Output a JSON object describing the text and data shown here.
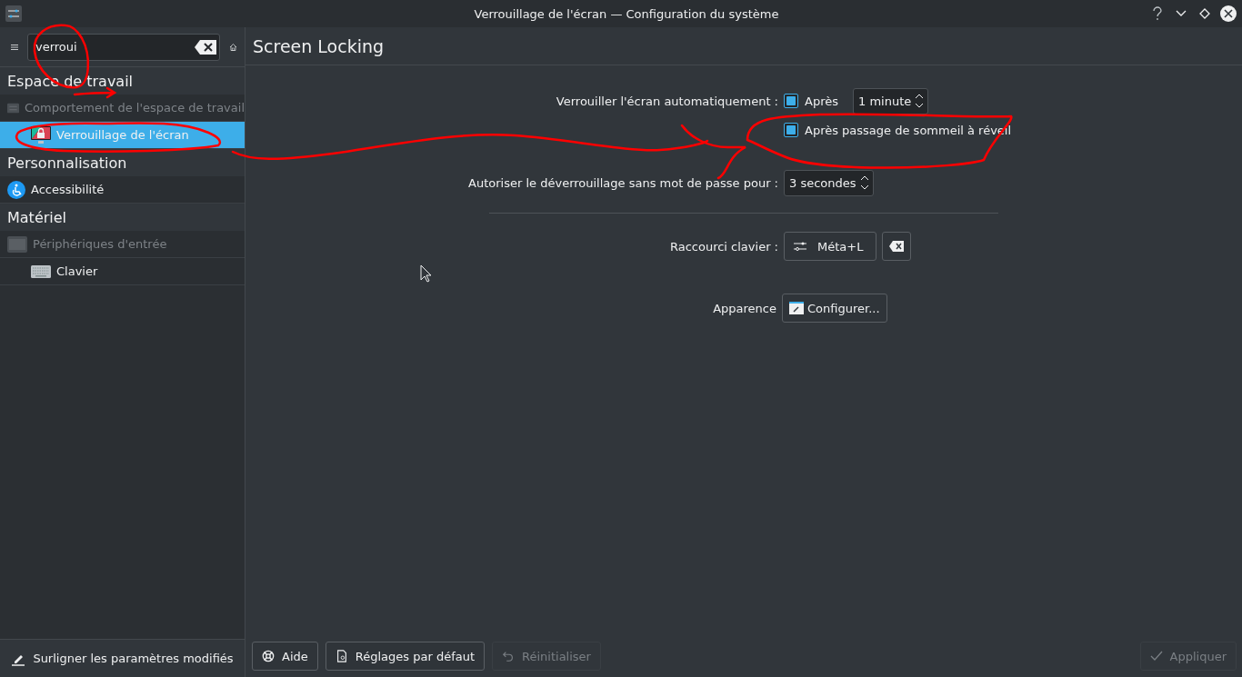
{
  "window": {
    "title": "Verrouillage de l'écran — Configuration du système"
  },
  "search": {
    "value": "verroui"
  },
  "sidebar": {
    "groups": [
      {
        "label": "Espace de travail",
        "items": [
          {
            "label": "Comportement de l'espace de travail",
            "kind": "settings",
            "disabled": true,
            "selected": false,
            "children": [
              {
                "label": "Verrouillage de l'écran",
                "kind": "monitor",
                "disabled": false,
                "selected": true
              }
            ]
          }
        ]
      },
      {
        "label": "Personnalisation",
        "items": [
          {
            "label": "Accessibilité",
            "kind": "accessibility",
            "disabled": false,
            "selected": false
          }
        ]
      },
      {
        "label": "Matériel",
        "items": [
          {
            "label": "Périphériques d'entrée",
            "kind": "device",
            "disabled": true,
            "selected": false,
            "children": [
              {
                "label": "Clavier",
                "kind": "keyboard",
                "disabled": false,
                "selected": false
              }
            ]
          }
        ]
      }
    ],
    "highlight_button": "Surligner les paramètres modifiés"
  },
  "page": {
    "title": "Screen Locking",
    "lock_label": "Verrouiller l'écran automatiquement :",
    "after_checkbox": {
      "label": "Après",
      "checked": true
    },
    "after_value": "1 minute",
    "sleep_checkbox": {
      "label": "Après passage de sommeil à réveil",
      "checked": true
    },
    "unlock_label": "Autoriser le déverrouillage sans mot de passe pour :",
    "unlock_value": "3 secondes",
    "shortcut_label": "Raccourci clavier :",
    "shortcut_value": "Méta+L",
    "appearance_label": "Apparence",
    "configure_button": "Configurer..."
  },
  "footer_buttons": [
    {
      "label": "Aide",
      "kind": "help",
      "disabled": false
    },
    {
      "label": "Réglages par défaut",
      "kind": "document",
      "disabled": false
    },
    {
      "label": "Réinitialiser",
      "kind": "undo",
      "disabled": true
    }
  ],
  "apply_button": {
    "label": "Appliquer",
    "disabled": true
  }
}
